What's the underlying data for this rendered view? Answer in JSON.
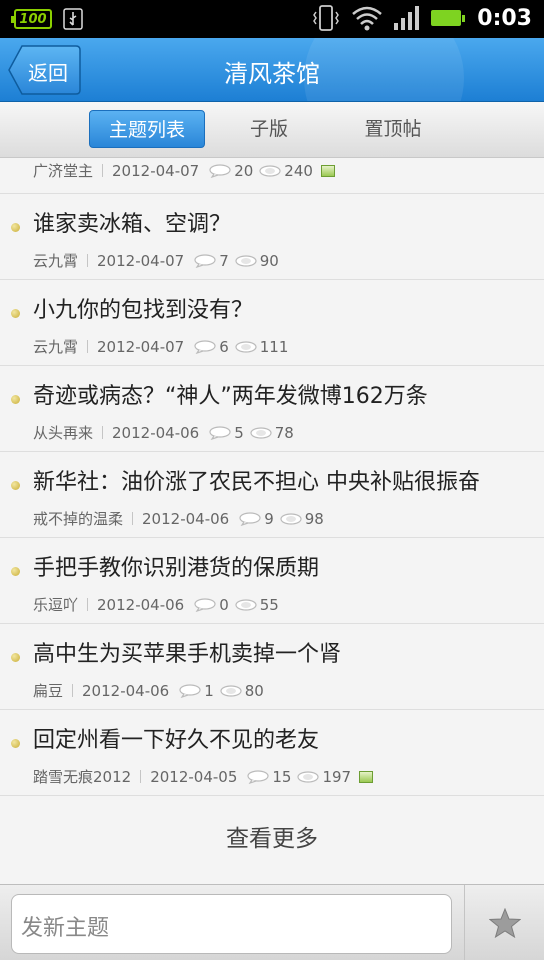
{
  "status_bar": {
    "battery_percent_label": "100",
    "time": "0:03",
    "icons": [
      "usb-icon",
      "vibrate-icon",
      "wifi-icon",
      "signal-icon",
      "battery-icon"
    ]
  },
  "header": {
    "back_label": "返回",
    "title": "清风茶馆"
  },
  "tabs": [
    {
      "label": "主题列表",
      "active": true
    },
    {
      "label": "子版",
      "active": false
    },
    {
      "label": "置顶帖",
      "active": false
    }
  ],
  "partial_item": {
    "author": "广济堂主",
    "date": "2012-04-07",
    "replies": "20",
    "views": "240",
    "has_image": true
  },
  "topics": [
    {
      "title": "谁家卖冰箱、空调？",
      "author": "云九霄",
      "date": "2012-04-07",
      "replies": "7",
      "views": "90",
      "has_image": false
    },
    {
      "title": "小九你的包找到没有？",
      "author": "云九霄",
      "date": "2012-04-07",
      "replies": "6",
      "views": "111",
      "has_image": false
    },
    {
      "title": "奇迹或病态？“神人”两年发微博162万条",
      "author": "从头再来",
      "date": "2012-04-06",
      "replies": "5",
      "views": "78",
      "has_image": false
    },
    {
      "title": "新华社：油价涨了农民不担心 中央补贴很振奋",
      "author": "戒不掉的温柔",
      "date": "2012-04-06",
      "replies": "9",
      "views": "98",
      "has_image": false
    },
    {
      "title": "手把手教你识别港货的保质期",
      "author": "乐逗吖",
      "date": "2012-04-06",
      "replies": "0",
      "views": "55",
      "has_image": false
    },
    {
      "title": "高中生为买苹果手机卖掉一个肾",
      "author": "扁豆",
      "date": "2012-04-06",
      "replies": "1",
      "views": "80",
      "has_image": false
    },
    {
      "title": "回定州看一下好久不见的老友",
      "author": "踏雪无痕2012",
      "date": "2012-04-05",
      "replies": "15",
      "views": "197",
      "has_image": true
    }
  ],
  "load_more_label": "查看更多",
  "compose": {
    "placeholder": "发新主题"
  },
  "favorite_icon": "star-icon"
}
